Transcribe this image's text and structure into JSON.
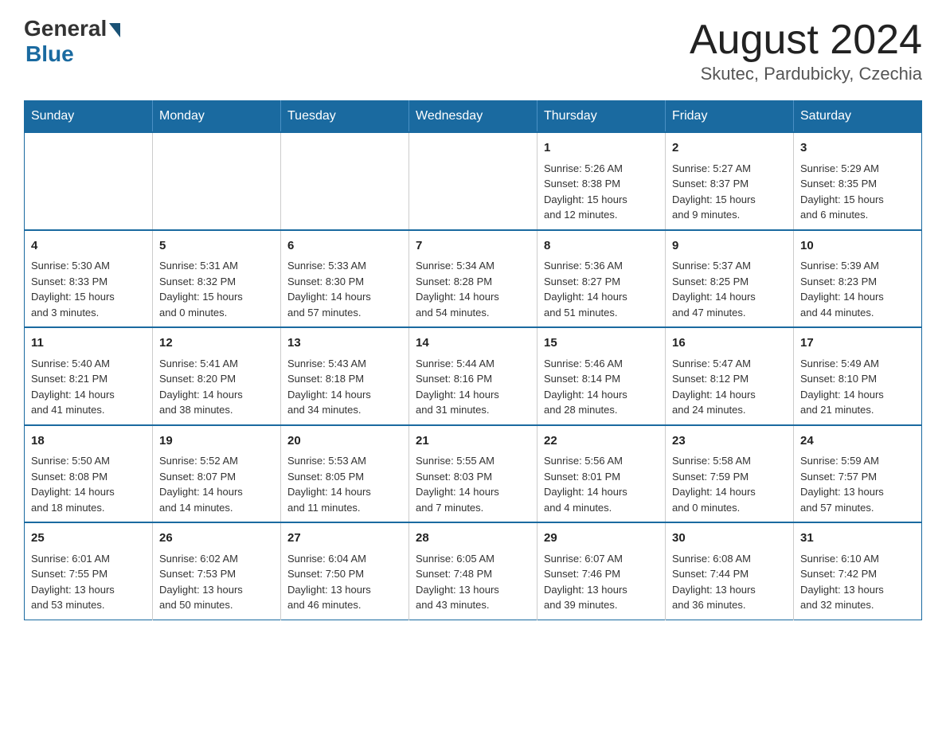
{
  "header": {
    "logo_text": "General",
    "logo_blue": "Blue",
    "title": "August 2024",
    "subtitle": "Skutec, Pardubicky, Czechia"
  },
  "weekdays": [
    "Sunday",
    "Monday",
    "Tuesday",
    "Wednesday",
    "Thursday",
    "Friday",
    "Saturday"
  ],
  "weeks": [
    [
      {
        "day": "",
        "info": ""
      },
      {
        "day": "",
        "info": ""
      },
      {
        "day": "",
        "info": ""
      },
      {
        "day": "",
        "info": ""
      },
      {
        "day": "1",
        "info": "Sunrise: 5:26 AM\nSunset: 8:38 PM\nDaylight: 15 hours\nand 12 minutes."
      },
      {
        "day": "2",
        "info": "Sunrise: 5:27 AM\nSunset: 8:37 PM\nDaylight: 15 hours\nand 9 minutes."
      },
      {
        "day": "3",
        "info": "Sunrise: 5:29 AM\nSunset: 8:35 PM\nDaylight: 15 hours\nand 6 minutes."
      }
    ],
    [
      {
        "day": "4",
        "info": "Sunrise: 5:30 AM\nSunset: 8:33 PM\nDaylight: 15 hours\nand 3 minutes."
      },
      {
        "day": "5",
        "info": "Sunrise: 5:31 AM\nSunset: 8:32 PM\nDaylight: 15 hours\nand 0 minutes."
      },
      {
        "day": "6",
        "info": "Sunrise: 5:33 AM\nSunset: 8:30 PM\nDaylight: 14 hours\nand 57 minutes."
      },
      {
        "day": "7",
        "info": "Sunrise: 5:34 AM\nSunset: 8:28 PM\nDaylight: 14 hours\nand 54 minutes."
      },
      {
        "day": "8",
        "info": "Sunrise: 5:36 AM\nSunset: 8:27 PM\nDaylight: 14 hours\nand 51 minutes."
      },
      {
        "day": "9",
        "info": "Sunrise: 5:37 AM\nSunset: 8:25 PM\nDaylight: 14 hours\nand 47 minutes."
      },
      {
        "day": "10",
        "info": "Sunrise: 5:39 AM\nSunset: 8:23 PM\nDaylight: 14 hours\nand 44 minutes."
      }
    ],
    [
      {
        "day": "11",
        "info": "Sunrise: 5:40 AM\nSunset: 8:21 PM\nDaylight: 14 hours\nand 41 minutes."
      },
      {
        "day": "12",
        "info": "Sunrise: 5:41 AM\nSunset: 8:20 PM\nDaylight: 14 hours\nand 38 minutes."
      },
      {
        "day": "13",
        "info": "Sunrise: 5:43 AM\nSunset: 8:18 PM\nDaylight: 14 hours\nand 34 minutes."
      },
      {
        "day": "14",
        "info": "Sunrise: 5:44 AM\nSunset: 8:16 PM\nDaylight: 14 hours\nand 31 minutes."
      },
      {
        "day": "15",
        "info": "Sunrise: 5:46 AM\nSunset: 8:14 PM\nDaylight: 14 hours\nand 28 minutes."
      },
      {
        "day": "16",
        "info": "Sunrise: 5:47 AM\nSunset: 8:12 PM\nDaylight: 14 hours\nand 24 minutes."
      },
      {
        "day": "17",
        "info": "Sunrise: 5:49 AM\nSunset: 8:10 PM\nDaylight: 14 hours\nand 21 minutes."
      }
    ],
    [
      {
        "day": "18",
        "info": "Sunrise: 5:50 AM\nSunset: 8:08 PM\nDaylight: 14 hours\nand 18 minutes."
      },
      {
        "day": "19",
        "info": "Sunrise: 5:52 AM\nSunset: 8:07 PM\nDaylight: 14 hours\nand 14 minutes."
      },
      {
        "day": "20",
        "info": "Sunrise: 5:53 AM\nSunset: 8:05 PM\nDaylight: 14 hours\nand 11 minutes."
      },
      {
        "day": "21",
        "info": "Sunrise: 5:55 AM\nSunset: 8:03 PM\nDaylight: 14 hours\nand 7 minutes."
      },
      {
        "day": "22",
        "info": "Sunrise: 5:56 AM\nSunset: 8:01 PM\nDaylight: 14 hours\nand 4 minutes."
      },
      {
        "day": "23",
        "info": "Sunrise: 5:58 AM\nSunset: 7:59 PM\nDaylight: 14 hours\nand 0 minutes."
      },
      {
        "day": "24",
        "info": "Sunrise: 5:59 AM\nSunset: 7:57 PM\nDaylight: 13 hours\nand 57 minutes."
      }
    ],
    [
      {
        "day": "25",
        "info": "Sunrise: 6:01 AM\nSunset: 7:55 PM\nDaylight: 13 hours\nand 53 minutes."
      },
      {
        "day": "26",
        "info": "Sunrise: 6:02 AM\nSunset: 7:53 PM\nDaylight: 13 hours\nand 50 minutes."
      },
      {
        "day": "27",
        "info": "Sunrise: 6:04 AM\nSunset: 7:50 PM\nDaylight: 13 hours\nand 46 minutes."
      },
      {
        "day": "28",
        "info": "Sunrise: 6:05 AM\nSunset: 7:48 PM\nDaylight: 13 hours\nand 43 minutes."
      },
      {
        "day": "29",
        "info": "Sunrise: 6:07 AM\nSunset: 7:46 PM\nDaylight: 13 hours\nand 39 minutes."
      },
      {
        "day": "30",
        "info": "Sunrise: 6:08 AM\nSunset: 7:44 PM\nDaylight: 13 hours\nand 36 minutes."
      },
      {
        "day": "31",
        "info": "Sunrise: 6:10 AM\nSunset: 7:42 PM\nDaylight: 13 hours\nand 32 minutes."
      }
    ]
  ]
}
